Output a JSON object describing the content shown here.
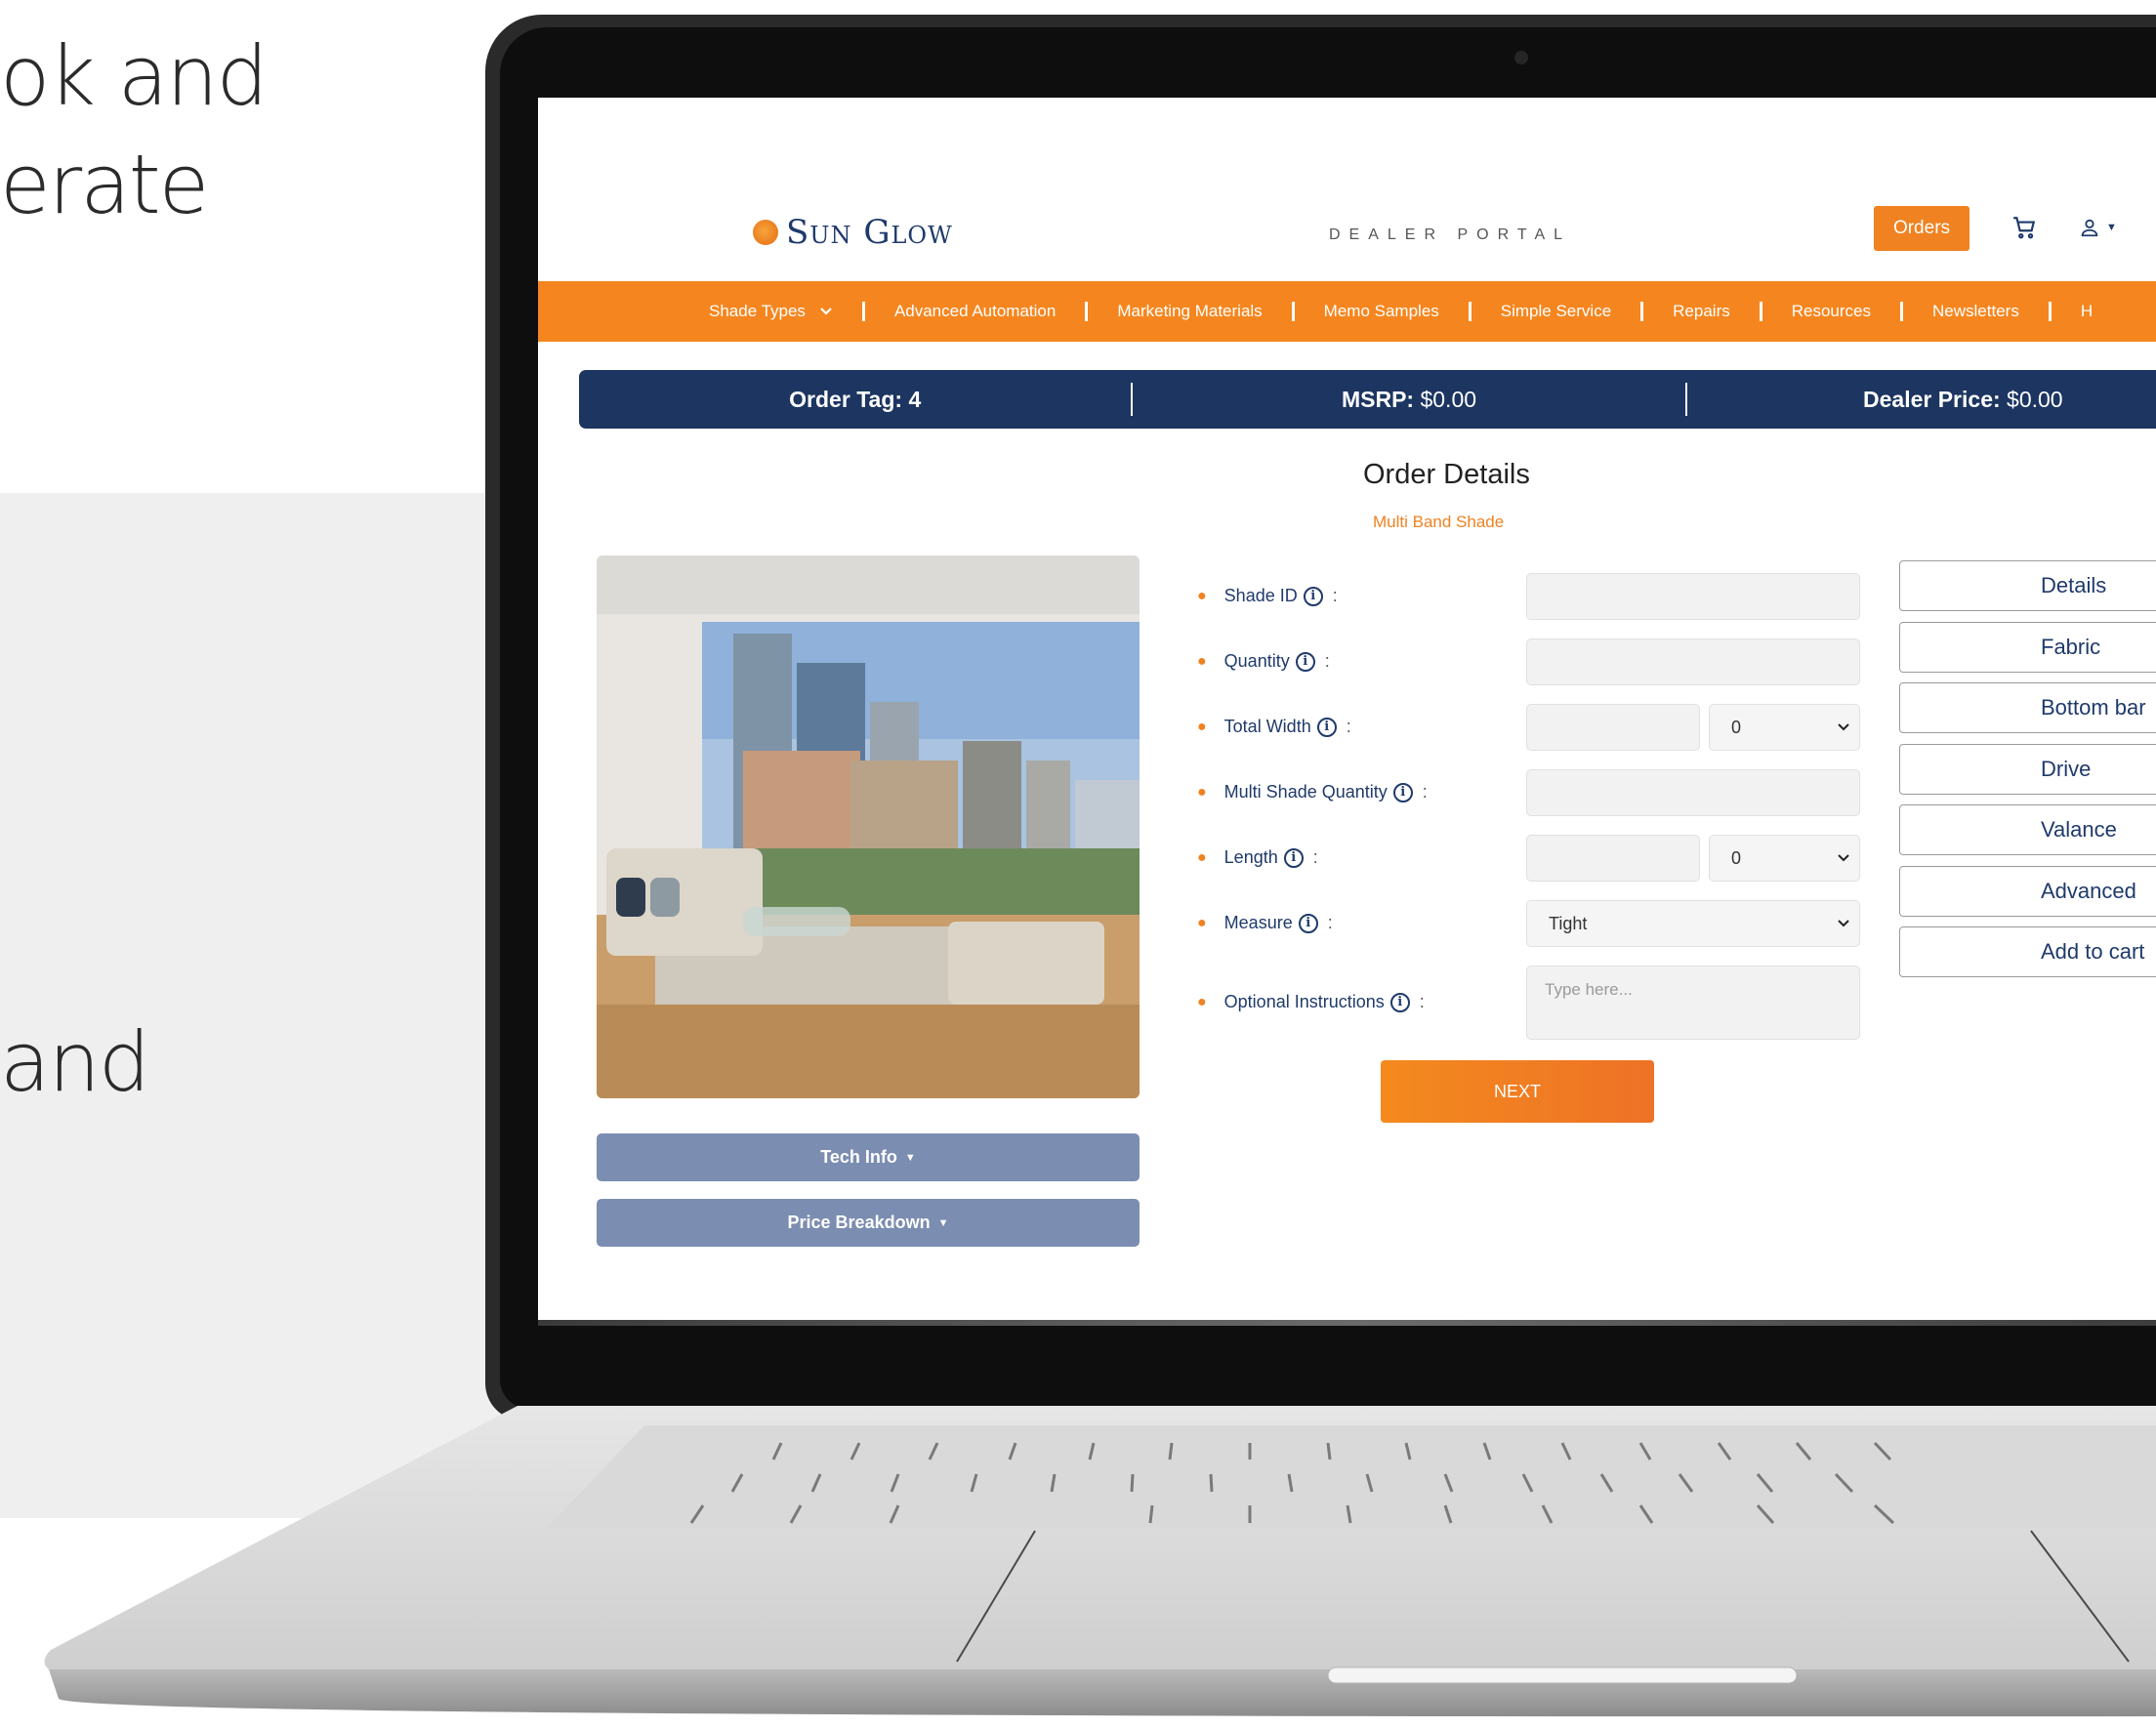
{
  "hero": {
    "line1": "ok and",
    "line2": "erate",
    "line3": "and"
  },
  "header": {
    "brand": "Sun Glow",
    "portal_label": "DEALER PORTAL",
    "orders_label": "Orders",
    "cart_icon": "cart-icon",
    "user_icon": "user-icon"
  },
  "nav": {
    "items": [
      {
        "label": "Shade Types"
      },
      {
        "label": "Advanced Automation"
      },
      {
        "label": "Marketing Materials"
      },
      {
        "label": "Memo Samples"
      },
      {
        "label": "Simple Service"
      },
      {
        "label": "Repairs"
      },
      {
        "label": "Resources"
      },
      {
        "label": "Newsletters"
      },
      {
        "label": "H"
      }
    ]
  },
  "order_bar": {
    "tag_label": "Order Tag:",
    "tag_value": "4",
    "msrp_label": "MSRP:",
    "msrp_value": "$0.00",
    "dealer_label": "Dealer Price:",
    "dealer_value": "$0.00"
  },
  "page": {
    "title": "Order Details",
    "subtitle": "Multi Band Shade"
  },
  "accordions": {
    "tech_info": "Tech Info",
    "price_breakdown": "Price Breakdown"
  },
  "form": {
    "shade_id_label": "Shade ID",
    "quantity_label": "Quantity",
    "total_width_label": "Total Width",
    "total_width_fraction": "0",
    "multi_qty_label": "Multi Shade Quantity",
    "length_label": "Length",
    "length_fraction": "0",
    "measure_label": "Measure",
    "measure_value": "Tight",
    "instructions_label": "Optional Instructions",
    "instructions_placeholder": "Type here...",
    "colon": ":",
    "next_label": "NEXT"
  },
  "side_menu": {
    "details": "Details",
    "fabric": "Fabric",
    "bottom_bar": "Bottom bar",
    "drive": "Drive",
    "valance": "Valance",
    "advanced": "Advanced",
    "add_to_cart": "Add to cart"
  },
  "colors": {
    "brand_orange": "#f5861f",
    "navy": "#1c3561",
    "accordion": "#7b8db0"
  }
}
